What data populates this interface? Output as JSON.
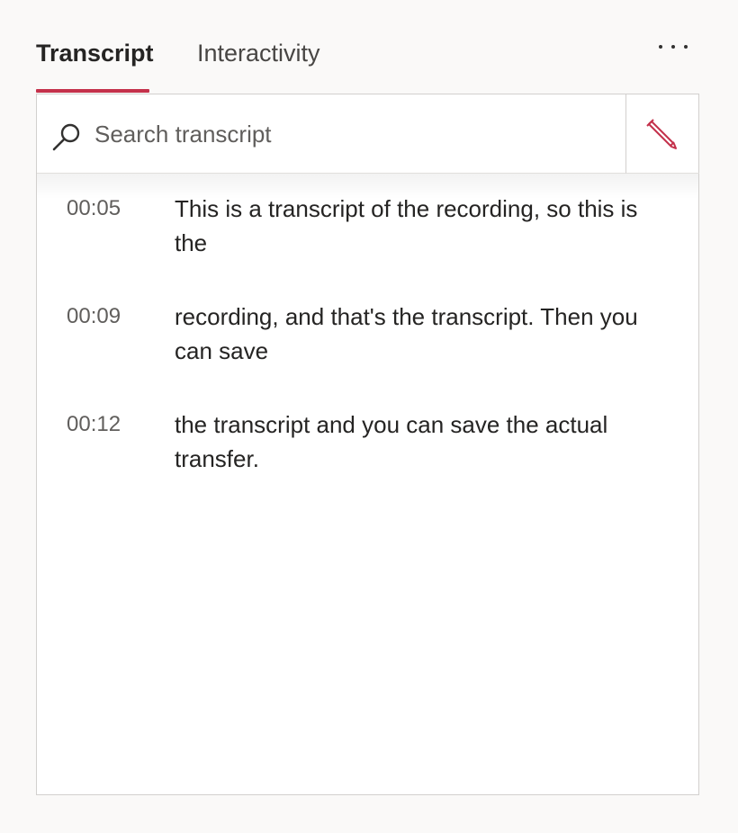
{
  "tabs": {
    "transcript_label": "Transcript",
    "interactivity_label": "Interactivity"
  },
  "colors": {
    "accent": "#c4314b",
    "background": "#faf9f8",
    "panel": "#ffffff"
  },
  "more_menu": {
    "icon": "more-horizontal-icon"
  },
  "search": {
    "placeholder": "Search transcript",
    "value": "",
    "icon": "search-icon"
  },
  "edit": {
    "icon": "pencil-icon"
  },
  "entries": [
    {
      "time": "00:05",
      "text": "This is a transcript of the recording, so this is the"
    },
    {
      "time": "00:09",
      "text": "recording, and that's the transcript. Then you can save"
    },
    {
      "time": "00:12",
      "text": "the transcript and you can save the actual transfer."
    }
  ]
}
